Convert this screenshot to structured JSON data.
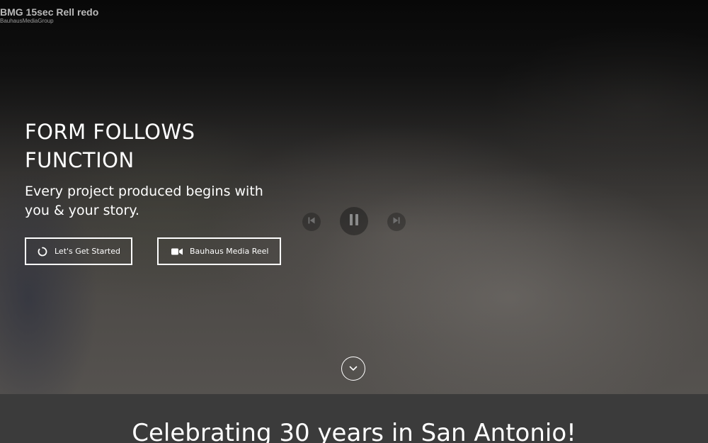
{
  "video": {
    "title": "BMG 15sec Rell redo",
    "channel": "BauhausMediaGroup",
    "controls": {
      "previous_icon": "skip-previous-icon",
      "pause_icon": "pause-icon",
      "next_icon": "skip-next-icon"
    }
  },
  "hero": {
    "headline": "FORM FOLLOWS FUNCTION",
    "subhead": "Every project produced begins with you & your story.",
    "buttons": [
      {
        "label": "Let's Get Started",
        "icon": "loading-circle-icon"
      },
      {
        "label": "Bauhaus Media Reel",
        "icon": "video-camera-icon"
      }
    ],
    "scroll_icon": "chevron-down-icon"
  },
  "section": {
    "title": "Celebrating 30 years in San Antonio!"
  },
  "colors": {
    "text": "#ffffff",
    "band": "#3b3b3b",
    "video_title": "#b9b9b9"
  }
}
